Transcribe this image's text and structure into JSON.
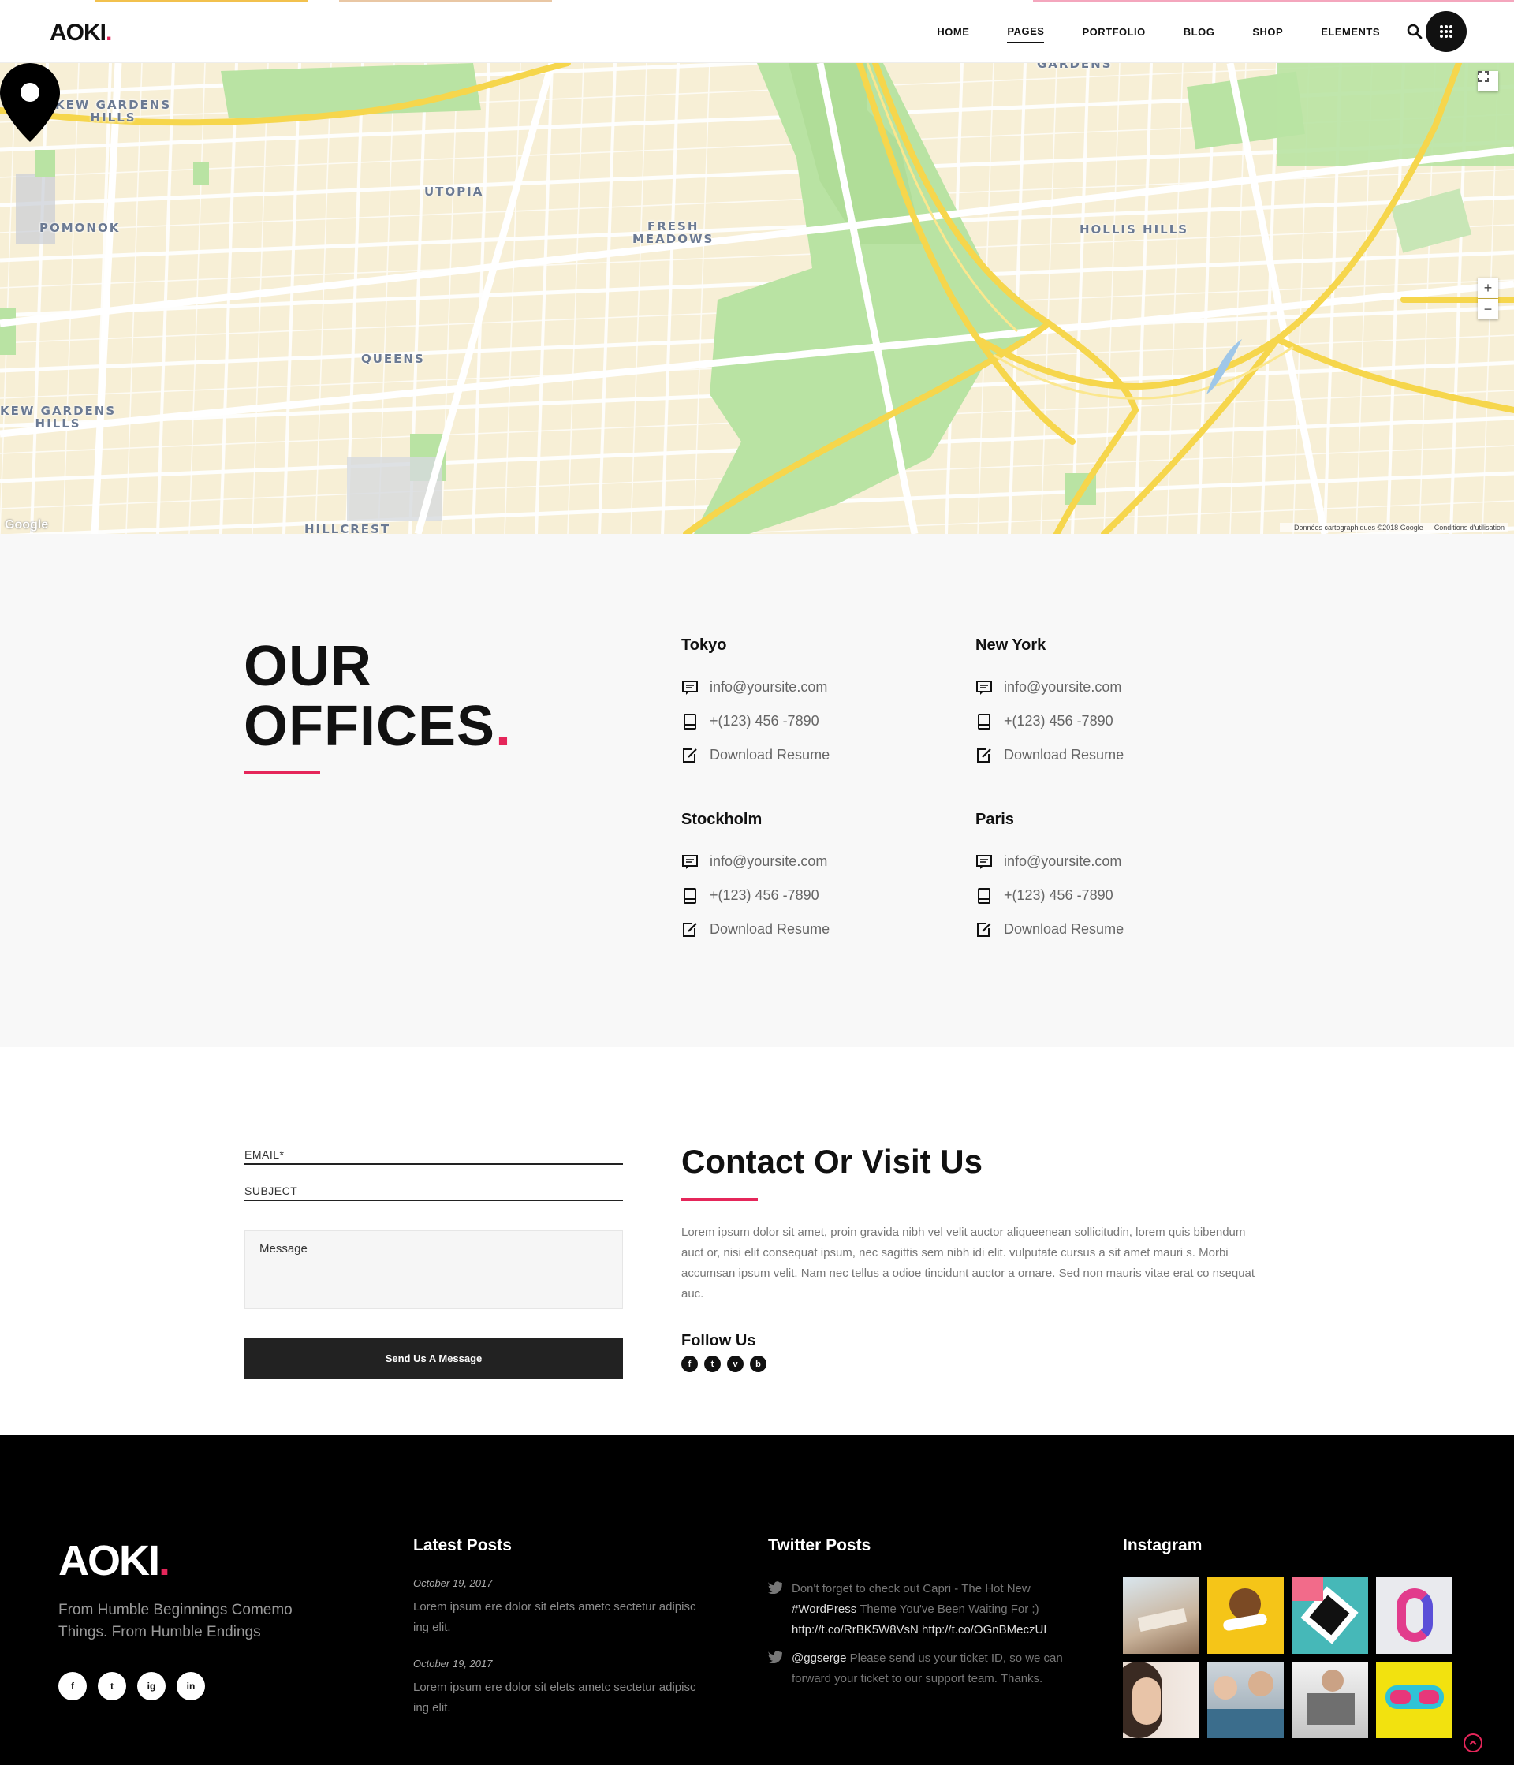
{
  "header": {
    "logo_text": "AOKI",
    "logo_dot": ".",
    "nav": [
      "HOME",
      "PAGES",
      "PORTFOLIO",
      "BLOG",
      "SHOP",
      "ELEMENTS"
    ],
    "active_nav": "PAGES",
    "icons": {
      "search": "search-icon",
      "menu": "grid-menu-icon"
    }
  },
  "map": {
    "labels": {
      "kew_gardens_hills_1": "KEW GARDENS\nHILLS",
      "kew_gardens_hills_2": "KEW GARDENS\nHILLS",
      "pomonok": "POMONOK",
      "utopia": "UTOPIA",
      "fresh_meadows": "FRESH\nMEADOWS",
      "hollis_hills": "HOLLIS HILLS",
      "queens": "QUEENS",
      "hillcrest": "HILLCREST",
      "gardens": "GARDENS"
    },
    "zoom_in": "+",
    "zoom_out": "−",
    "google": "Google",
    "attribution": "Données cartographiques ©2018 Google",
    "terms": "Conditions d'utilisation"
  },
  "offices": {
    "title_line1": "OUR",
    "title_line2": "OFFICES",
    "title_dot": ".",
    "list": [
      {
        "city": "Tokyo",
        "email": "info@yoursite.com",
        "phone": "+(123) 456 -7890",
        "resume": "Download Resume"
      },
      {
        "city": "New York",
        "email": "info@yoursite.com",
        "phone": "+(123) 456 -7890",
        "resume": "Download Resume"
      },
      {
        "city": "Stockholm",
        "email": "info@yoursite.com",
        "phone": "+(123) 456 -7890",
        "resume": "Download Resume"
      },
      {
        "city": "Paris",
        "email": "info@yoursite.com",
        "phone": "+(123) 456 -7890",
        "resume": "Download Resume"
      }
    ]
  },
  "contact": {
    "email_label": "EMAIL*",
    "subject_label": "SUBJECT",
    "message_placeholder": "Message",
    "send_label": "Send Us A Message",
    "title": "Contact Or Visit Us",
    "text": "Lorem ipsum dolor sit amet, proin gravida nibh vel velit auctor aliqueenean sollicitudin, lorem quis bibendum auct or, nisi elit consequat ipsum, nec sagittis sem nibh idi elit. vulputate cursus a sit amet mauri s. Morbi accumsan ipsum velit. Nam nec tellus a odioe tincidunt auctor a ornare. Sed non mauris vitae erat co nsequat auc.",
    "follow_title": "Follow Us",
    "follow_icons": [
      "f",
      "t",
      "v",
      "b"
    ]
  },
  "footer": {
    "logo_text": "AOKI",
    "logo_dot": ".",
    "tagline": "From Humble Beginnings Comemo Things. From Humble Endings",
    "social": [
      "f",
      "t",
      "ig",
      "in"
    ],
    "latest_title": "Latest Posts",
    "posts": [
      {
        "date": "October 19, 2017",
        "text": "Lorem ipsum ere dolor sit elets ametc sectetur adipisc ing elit."
      },
      {
        "date": "October 19, 2017",
        "text": "Lorem ipsum ere dolor sit elets ametc sectetur adipisc ing elit."
      }
    ],
    "twitter_title": "Twitter Posts",
    "tweets": [
      {
        "pre": "Don't forget to check out Capri - The Hot New ",
        "tag": "#WordPress",
        "mid": " Theme You've Been Waiting For ;) ",
        "links": "http://t.co/RrBK5W8VsN http://t.co/OGnBMeczUI"
      },
      {
        "handle": "@ggserge",
        "text": " Please send us your ticket ID, so we can forward your ticket to our support team. Thanks."
      }
    ],
    "instagram_title": "Instagram",
    "colors": {
      "accent": "#e5265a",
      "dark": "#111111"
    }
  }
}
